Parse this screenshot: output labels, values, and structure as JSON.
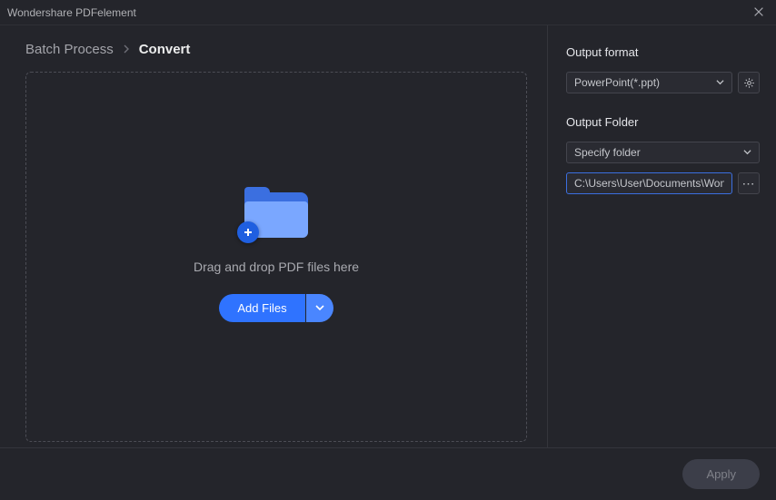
{
  "app_title": "Wondershare PDFelement",
  "breadcrumb": {
    "root": "Batch Process",
    "current": "Convert"
  },
  "dropzone": {
    "hint": "Drag and drop PDF files here",
    "add_button": "Add Files"
  },
  "right_panel": {
    "output_format_label": "Output format",
    "output_format_value": "PowerPoint(*.ppt)",
    "output_folder_label": "Output Folder",
    "folder_mode_value": "Specify folder",
    "folder_path_value": "C:\\Users\\User\\Documents\\Wondershare"
  },
  "footer": {
    "apply_label": "Apply"
  },
  "icons": {
    "close": "close-icon",
    "chevron_right": "chevron-right-icon",
    "chevron_down": "chevron-down-icon",
    "folder_plus": "folder-add-icon",
    "gear": "gear-icon",
    "browse": "ellipsis-icon"
  },
  "colors": {
    "accent_blue": "#2f73ff",
    "folder_light": "#7aa7ff",
    "folder_dark": "#3b6fe0",
    "bg": "#24252b",
    "border": "#44454d",
    "text_muted": "#a3a4aa"
  }
}
